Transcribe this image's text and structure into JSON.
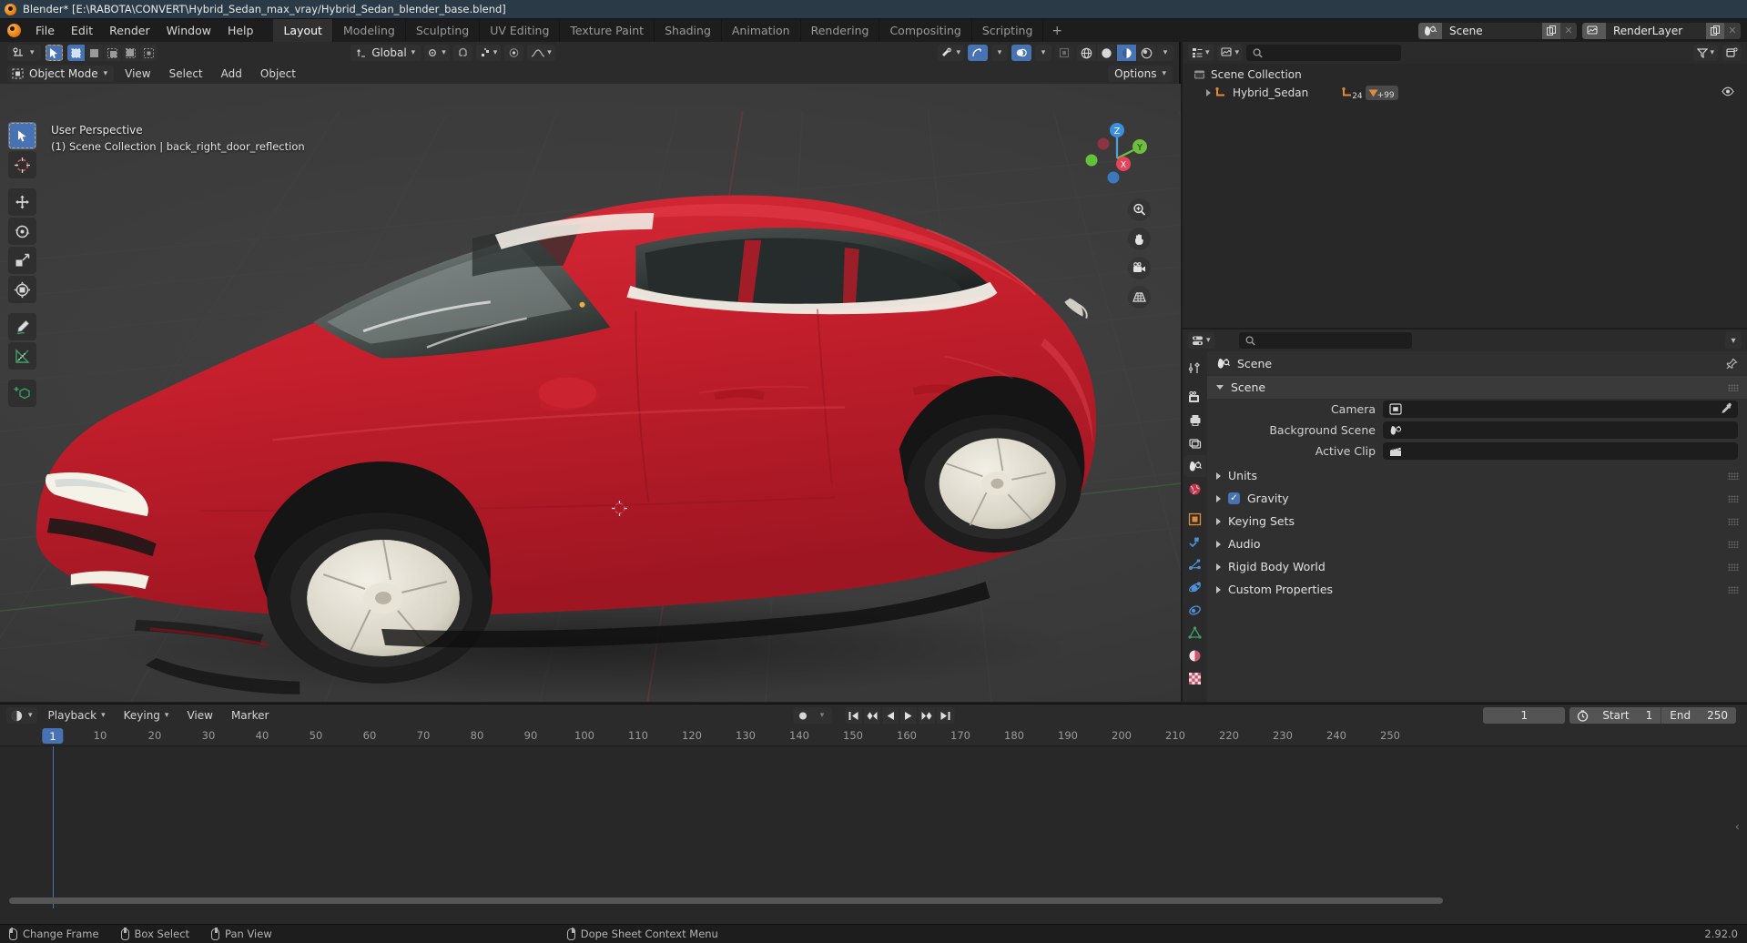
{
  "titlebar": {
    "text": "Blender* [E:\\RABOTA\\CONVERT\\Hybrid_Sedan_max_vray/Hybrid_Sedan_blender_base.blend]",
    "icon": "blender-logo-icon"
  },
  "topbar": {
    "menus": [
      "File",
      "Edit",
      "Render",
      "Window",
      "Help"
    ],
    "workspaces": [
      {
        "label": "Layout",
        "active": true
      },
      {
        "label": "Modeling",
        "active": false
      },
      {
        "label": "Sculpting",
        "active": false
      },
      {
        "label": "UV Editing",
        "active": false
      },
      {
        "label": "Texture Paint",
        "active": false
      },
      {
        "label": "Shading",
        "active": false
      },
      {
        "label": "Animation",
        "active": false
      },
      {
        "label": "Rendering",
        "active": false
      },
      {
        "label": "Compositing",
        "active": false
      },
      {
        "label": "Scripting",
        "active": false
      }
    ],
    "add_workspace": "+",
    "scene": {
      "name": "Scene",
      "icon": "scene-icon"
    },
    "view_layer": {
      "name": "RenderLayer",
      "icon": "view-layer-icon"
    }
  },
  "viewport": {
    "editor_type_icon": "editor-type-icon",
    "select_tools": [
      "tweak",
      "select-box",
      "select-circle",
      "select-lasso"
    ],
    "mode": "Object Mode",
    "menus": [
      "View",
      "Select",
      "Add",
      "Object"
    ],
    "transform_orientation": "Global",
    "snap_icon": "magnet-icon",
    "proportional_icon": "proportional-edit-icon",
    "options_label": "Options",
    "overlay_line1": "User Perspective",
    "overlay_line2": "(1) Scene Collection | back_right_door_reflection",
    "gizmo_axes": [
      "X",
      "Y",
      "Z"
    ],
    "nav_buttons": [
      "zoom-icon",
      "pan-icon",
      "camera-icon",
      "orthographic-grid-icon"
    ],
    "shading_modes": [
      "wireframe",
      "solid",
      "material-preview",
      "rendered"
    ],
    "active_shading_mode": "material-preview",
    "tools": [
      "tweak-tool",
      "cursor-tool",
      "move-tool",
      "rotate-tool",
      "scale-tool",
      "transform-tool",
      "annotate-tool",
      "measure-tool",
      "add-cube-tool"
    ]
  },
  "outliner": {
    "display_mode_icon": "outliner-display-mode-icon",
    "filter_icon": "filter-icon",
    "new_collection_icon": "new-collection-icon",
    "search_placeholder": "",
    "rows": [
      {
        "label": "Scene Collection",
        "icon": "collection-icon",
        "indent": false,
        "expandable": false
      },
      {
        "label": "Hybrid_Sedan",
        "icon": "armature-icon",
        "indent": true,
        "expandable": true,
        "mesh_count": "24",
        "modifier_count": "+99",
        "visible": true
      }
    ]
  },
  "properties": {
    "search_placeholder": "",
    "tabs": [
      "tool-tab",
      "render-tab",
      "output-tab",
      "view-layer-tab",
      "scene-tab",
      "world-tab",
      "object-tab",
      "modifier-tab",
      "particles-tab",
      "physics-tab",
      "constraint-tab",
      "data-tab",
      "material-tab",
      "texture-tab"
    ],
    "active_tab": "scene-tab",
    "breadcrumb": "Scene",
    "panels": [
      {
        "label": "Scene",
        "open": true,
        "fields": [
          {
            "label": "Camera",
            "value": "",
            "icon": "camera-data-icon",
            "eyedropper": true
          },
          {
            "label": "Background Scene",
            "value": "",
            "icon": "scene-icon",
            "eyedropper": false
          },
          {
            "label": "Active Clip",
            "value": "",
            "icon": "clip-icon",
            "eyedropper": false
          }
        ]
      },
      {
        "label": "Units",
        "open": false,
        "checkbox": null
      },
      {
        "label": "Gravity",
        "open": false,
        "checkbox": true
      },
      {
        "label": "Keying Sets",
        "open": false,
        "checkbox": null
      },
      {
        "label": "Audio",
        "open": false,
        "checkbox": null
      },
      {
        "label": "Rigid Body World",
        "open": false,
        "checkbox": null
      },
      {
        "label": "Custom Properties",
        "open": false,
        "checkbox": null
      }
    ]
  },
  "timeline": {
    "editor_icon": "timeline-editor-icon",
    "menus": [
      "Playback",
      "Keying",
      "View",
      "Marker"
    ],
    "transport": [
      "jump-start",
      "prev-keyframe",
      "play-reverse",
      "play",
      "next-keyframe",
      "jump-end"
    ],
    "record_icon": "auto-keying-icon",
    "current_frame": "1",
    "start_label": "Start",
    "start_value": "1",
    "end_label": "End",
    "end_value": "250",
    "ruler_ticks": [
      "10",
      "20",
      "30",
      "40",
      "50",
      "60",
      "70",
      "80",
      "90",
      "100",
      "110",
      "120",
      "130",
      "140",
      "150",
      "160",
      "170",
      "180",
      "190",
      "200",
      "210",
      "220",
      "230",
      "240",
      "250"
    ],
    "playhead_label": "1"
  },
  "statusbar": {
    "hints": [
      {
        "mouse": "lmb",
        "label": "Change Frame"
      },
      {
        "mouse": "mmb",
        "label": "Box Select"
      },
      {
        "mouse": "mmb2",
        "label": "Pan View"
      },
      {
        "mouse": "rmb",
        "label": "Dope Sheet Context Menu"
      }
    ],
    "version": "2.92.0"
  },
  "colors": {
    "accent": "#4772b3",
    "title_bg": "#2b3a47",
    "header_bg": "#2b2b2b",
    "viewport_bg": "#3a3a3a",
    "car_body": "#c8202f",
    "orange": "#e87d0d"
  }
}
